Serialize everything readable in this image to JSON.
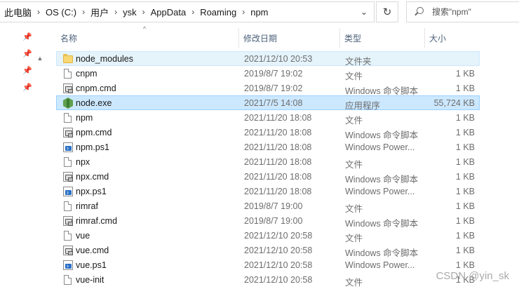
{
  "address": {
    "crumbs": [
      "此电脑",
      "OS (C:)",
      "用户",
      "ysk",
      "AppData",
      "Roaming",
      "npm"
    ]
  },
  "search": {
    "placeholder": "搜索\"npm\""
  },
  "columns": {
    "name": "名称",
    "date": "修改日期",
    "type": "类型",
    "size": "大小"
  },
  "files": [
    {
      "name": "node_modules",
      "date": "2021/12/10 20:53",
      "type": "文件夹",
      "size": "",
      "icon": "folder-icon",
      "state": "hl"
    },
    {
      "name": "cnpm",
      "date": "2019/8/7 19:02",
      "type": "文件",
      "size": "1 KB",
      "icon": "file-icon",
      "state": ""
    },
    {
      "name": "cnpm.cmd",
      "date": "2019/8/7 19:02",
      "type": "Windows 命令脚本",
      "size": "1 KB",
      "icon": "cmd-script-icon",
      "state": ""
    },
    {
      "name": "node.exe",
      "date": "2021/7/5 14:08",
      "type": "应用程序",
      "size": "55,724 KB",
      "icon": "nodejs-exe-icon",
      "state": "sel"
    },
    {
      "name": "npm",
      "date": "2021/11/20 18:08",
      "type": "文件",
      "size": "1 KB",
      "icon": "file-icon",
      "state": ""
    },
    {
      "name": "npm.cmd",
      "date": "2021/11/20 18:08",
      "type": "Windows 命令脚本",
      "size": "1 KB",
      "icon": "cmd-script-icon",
      "state": ""
    },
    {
      "name": "npm.ps1",
      "date": "2021/11/20 18:08",
      "type": "Windows Power...",
      "size": "1 KB",
      "icon": "powershell-script-icon",
      "state": ""
    },
    {
      "name": "npx",
      "date": "2021/11/20 18:08",
      "type": "文件",
      "size": "1 KB",
      "icon": "file-icon",
      "state": ""
    },
    {
      "name": "npx.cmd",
      "date": "2021/11/20 18:08",
      "type": "Windows 命令脚本",
      "size": "1 KB",
      "icon": "cmd-script-icon",
      "state": ""
    },
    {
      "name": "npx.ps1",
      "date": "2021/11/20 18:08",
      "type": "Windows Power...",
      "size": "1 KB",
      "icon": "powershell-script-icon",
      "state": ""
    },
    {
      "name": "rimraf",
      "date": "2019/8/7 19:00",
      "type": "文件",
      "size": "1 KB",
      "icon": "file-icon",
      "state": ""
    },
    {
      "name": "rimraf.cmd",
      "date": "2019/8/7 19:00",
      "type": "Windows 命令脚本",
      "size": "1 KB",
      "icon": "cmd-script-icon",
      "state": ""
    },
    {
      "name": "vue",
      "date": "2021/12/10 20:58",
      "type": "文件",
      "size": "1 KB",
      "icon": "file-icon",
      "state": ""
    },
    {
      "name": "vue.cmd",
      "date": "2021/12/10 20:58",
      "type": "Windows 命令脚本",
      "size": "1 KB",
      "icon": "cmd-script-icon",
      "state": ""
    },
    {
      "name": "vue.ps1",
      "date": "2021/12/10 20:58",
      "type": "Windows Power...",
      "size": "1 KB",
      "icon": "powershell-script-icon",
      "state": ""
    },
    {
      "name": "vue-init",
      "date": "2021/12/10 20:58",
      "type": "文件",
      "size": "1 KB",
      "icon": "file-icon",
      "state": ""
    }
  ],
  "watermark": "CSDN @yin_sk"
}
